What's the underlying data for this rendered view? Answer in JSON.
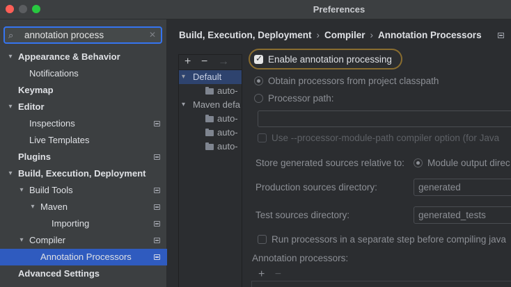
{
  "window": {
    "title": "Preferences"
  },
  "search": {
    "value": "annotation process",
    "icon": "search-icon"
  },
  "tree": {
    "appearance": "Appearance & Behavior",
    "notifications": "Notifications",
    "keymap": "Keymap",
    "editor": "Editor",
    "inspections": "Inspections",
    "live_templates": "Live Templates",
    "plugins": "Plugins",
    "build": "Build, Execution, Deployment",
    "build_tools": "Build Tools",
    "maven": "Maven",
    "importing": "Importing",
    "compiler": "Compiler",
    "annotation_processors": "Annotation Processors",
    "advanced": "Advanced Settings"
  },
  "breadcrumb": {
    "part1": "Build, Execution, Deployment",
    "part2": "Compiler",
    "part3": "Annotation Processors"
  },
  "profiles": {
    "add": "+",
    "remove": "−",
    "move": "→",
    "default": "Default",
    "default_child": "auto-",
    "maven_default": "Maven defa",
    "maven_children": [
      "auto-",
      "auto-",
      "auto-"
    ]
  },
  "settings": {
    "enable_label": "Enable annotation processing",
    "enable_checked": true,
    "obtain_label": "Obtain processors from project classpath",
    "processor_path_label": "Processor path:",
    "module_path_label": "Use --processor-module-path compiler option (for Java",
    "store_label": "Store generated sources relative to:",
    "module_output_label": "Module output direc",
    "production_label": "Production sources directory:",
    "production_value": "generated",
    "test_label": "Test sources directory:",
    "test_value": "generated_tests",
    "separate_step_label": "Run processors in a separate step before compiling java",
    "annotation_processors_label": "Annotation processors:",
    "ap_add": "+",
    "ap_remove": "−"
  }
}
